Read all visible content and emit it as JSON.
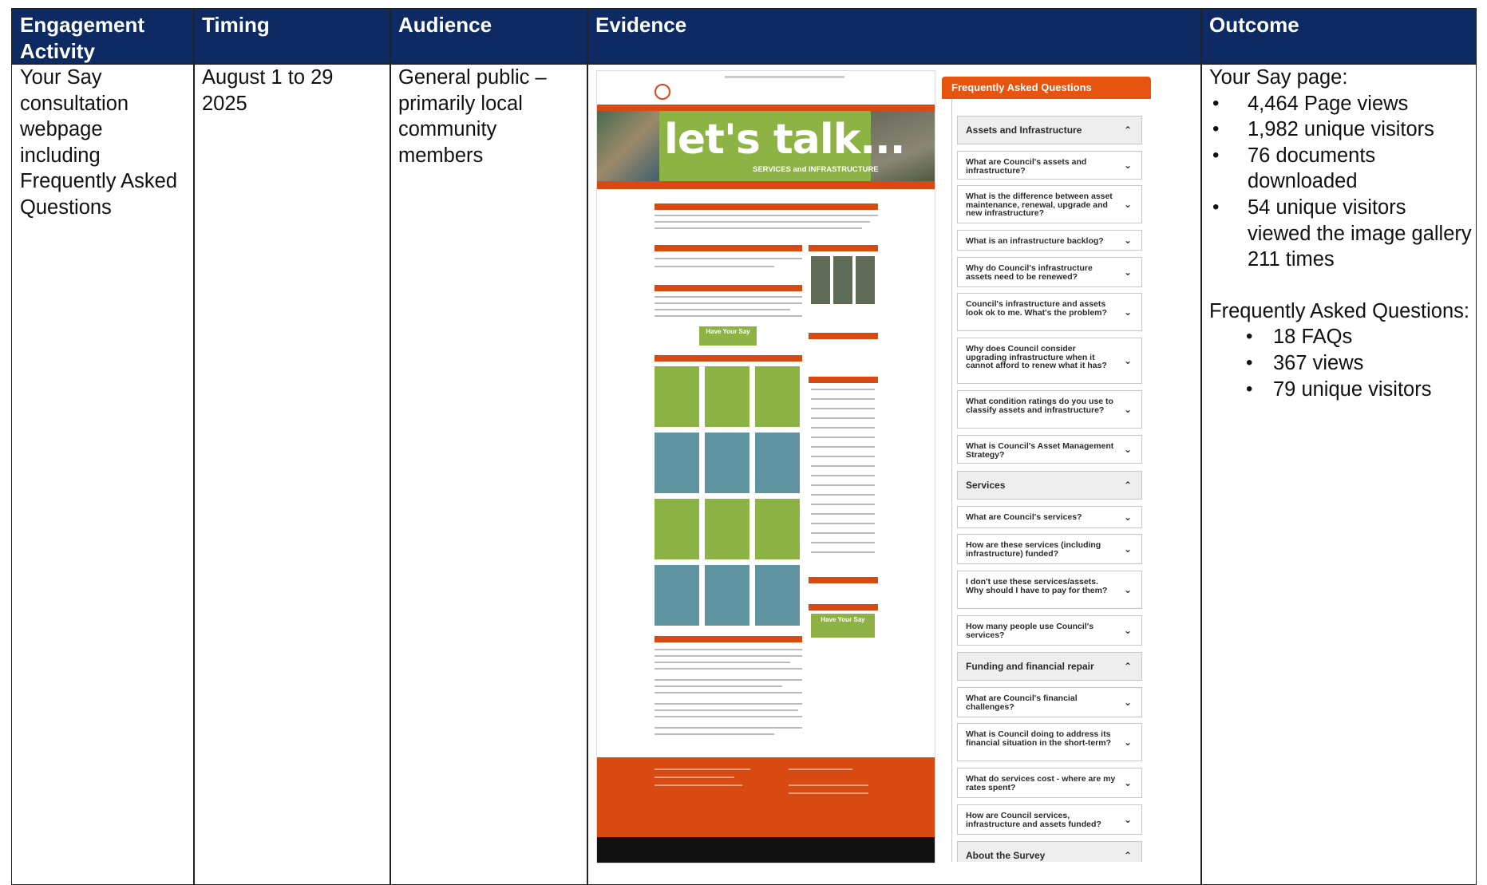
{
  "table": {
    "headers": {
      "activity": "Engagement Activity",
      "timing": "Timing",
      "audience": "Audience",
      "evidence": "Evidence",
      "outcome": "Outcome"
    },
    "row": {
      "activity": "Your Say consultation webpage including Frequently Asked Questions",
      "timing": "August 1 to 29 2025",
      "audience": "General public – primarily local community members",
      "outcome": {
        "yoursay_title": "Your Say page:",
        "yoursay_items": [
          "4,464 Page views",
          "1,982 unique visitors",
          "76 documents downloaded",
          "54 unique visitors viewed the image gallery 211 times"
        ],
        "faq_title": "Frequently Asked Questions:",
        "faq_items": [
          "18 FAQs",
          "367 views",
          "79 unique visitors"
        ]
      }
    }
  },
  "evidence": {
    "webpage": {
      "banner_title": "let's talk...",
      "banner_sub": "SERVICES and INFRASTRUCTURE",
      "cta1": "Have Your Say",
      "cta2": "Have Your Say"
    },
    "faq_panel": {
      "heading": "Frequently Asked Questions",
      "items": [
        {
          "label": "Assets and Infrastructure",
          "category": true,
          "expanded": true
        },
        {
          "label": "What are Council's assets and infrastructure?",
          "category": false
        },
        {
          "label": "What is the difference between asset maintenance, renewal, upgrade and new infrastructure?",
          "category": false
        },
        {
          "label": "What is an infrastructure backlog?",
          "category": false
        },
        {
          "label": "Why do Council's infrastructure assets need to be renewed?",
          "category": false
        },
        {
          "label": "Council's infrastructure and assets look ok to me. What's the problem?",
          "category": false
        },
        {
          "label": "Why does Council consider upgrading infrastructure when it cannot afford to renew what it has?",
          "category": false
        },
        {
          "label": "What condition ratings do you use to classify assets and infrastructure?",
          "category": false
        },
        {
          "label": "What is Council's Asset Management Strategy?",
          "category": false
        },
        {
          "label": "Services",
          "category": true,
          "expanded": true
        },
        {
          "label": "What are Council's services?",
          "category": false
        },
        {
          "label": "How are these services (including infrastructure) funded?",
          "category": false
        },
        {
          "label": "I don't use these services/assets. Why should I have to pay for them?",
          "category": false
        },
        {
          "label": "How many people use Council's services?",
          "category": false
        },
        {
          "label": "Funding and financial repair",
          "category": true,
          "expanded": true
        },
        {
          "label": "What are Council's financial challenges?",
          "category": false
        },
        {
          "label": "What is Council doing to address its financial situation in the short-term?",
          "category": false
        },
        {
          "label": "What do services cost - where are my rates spent?",
          "category": false
        },
        {
          "label": "How are Council services, infrastructure and assets funded?",
          "category": false
        },
        {
          "label": "About the Survey",
          "category": true,
          "expanded": true
        }
      ]
    }
  }
}
